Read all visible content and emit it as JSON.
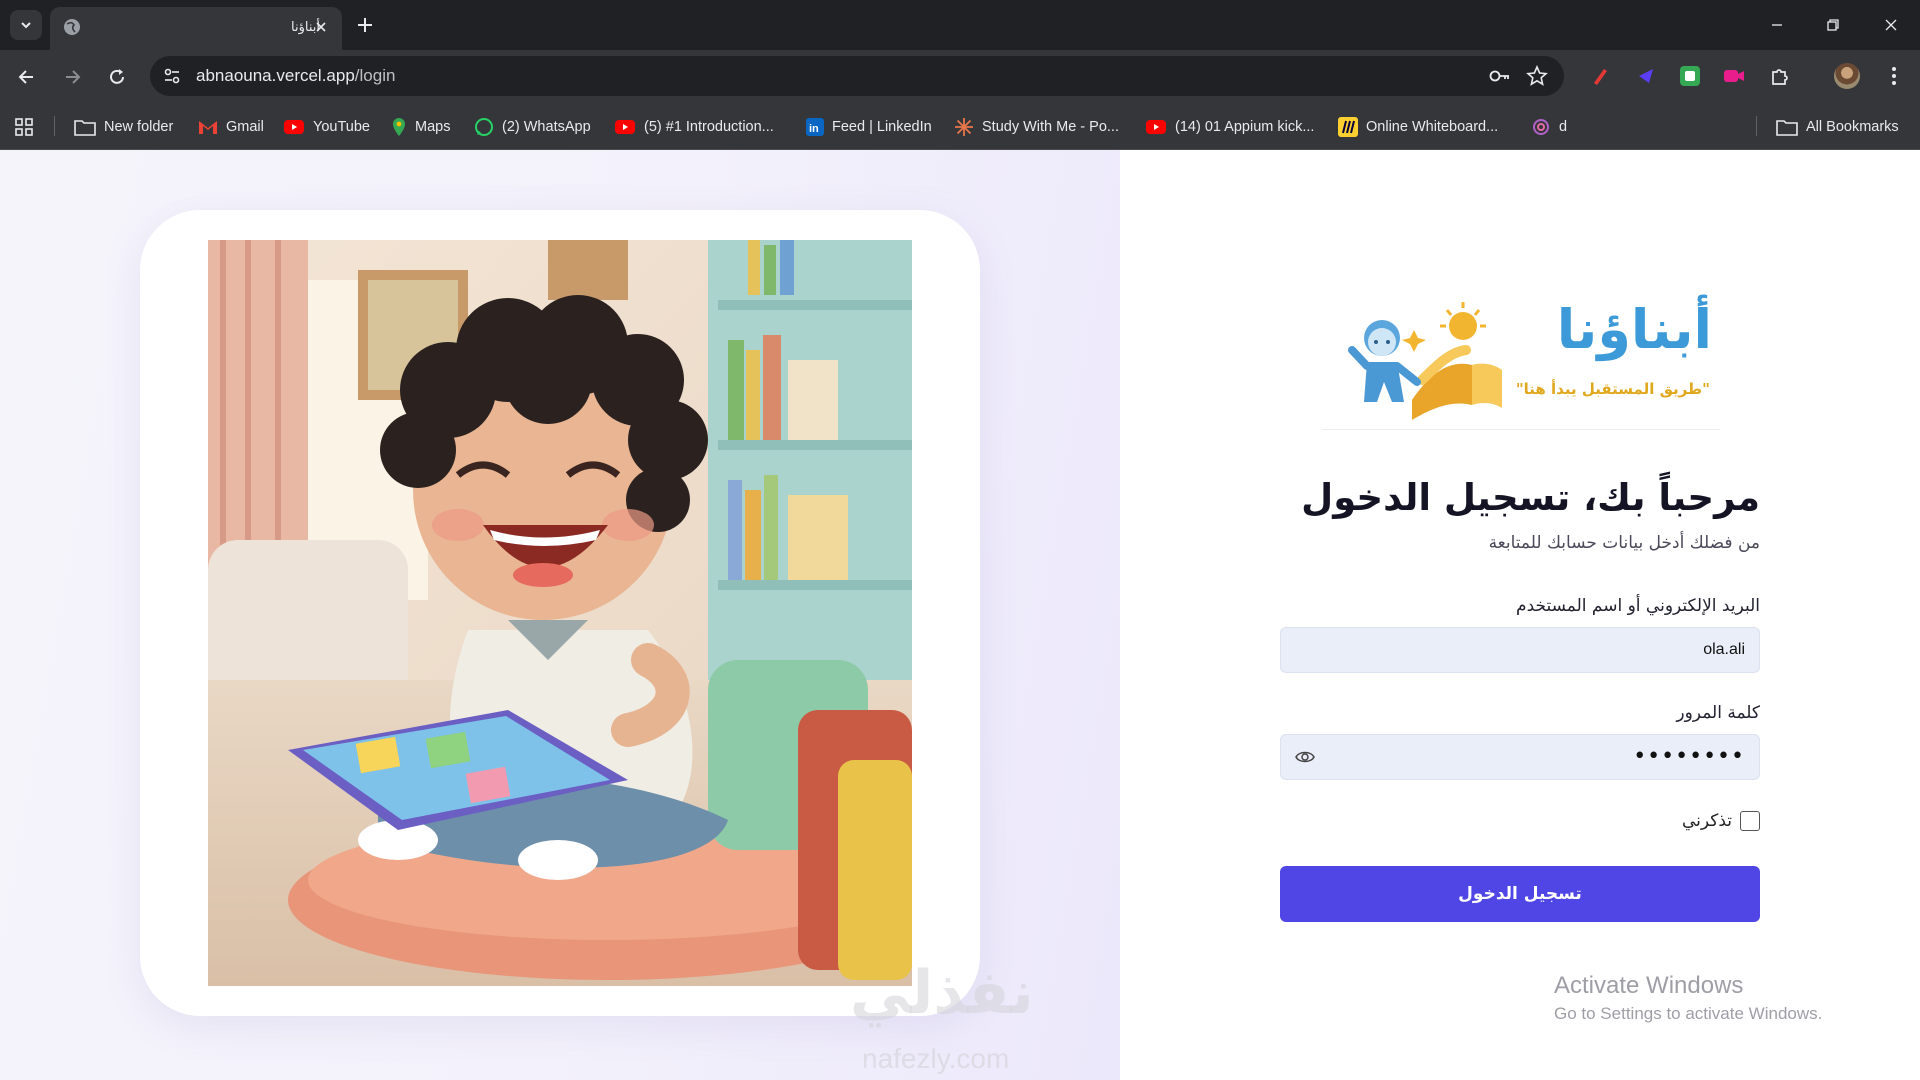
{
  "browser": {
    "tab": {
      "title": "أبناؤنا"
    },
    "url": {
      "host": "abnaouna.vercel.app",
      "path": "/login"
    },
    "bookmarks": [
      {
        "label": "New folder",
        "icon": "folder-icon"
      },
      {
        "label": "Gmail",
        "icon": "gmail-icon"
      },
      {
        "label": "YouTube",
        "icon": "youtube-icon"
      },
      {
        "label": "Maps",
        "icon": "maps-icon"
      },
      {
        "label": "(2) WhatsApp",
        "icon": "whatsapp-icon"
      },
      {
        "label": "(5) #1 Introduction...",
        "icon": "youtube-icon"
      },
      {
        "label": "Feed | LinkedIn",
        "icon": "linkedin-icon"
      },
      {
        "label": "Study With Me - Po...",
        "icon": "sparkle-icon"
      },
      {
        "label": "(14) 01 Appium kick...",
        "icon": "youtube-icon"
      },
      {
        "label": "Online Whiteboard...",
        "icon": "miro-icon"
      },
      {
        "label": "d",
        "icon": "spiral-icon"
      }
    ],
    "all_bookmarks": "All Bookmarks"
  },
  "brand": {
    "name": "أبناؤنا",
    "tagline": "\"طريق المستقبل يبدأ هنا\"",
    "colors": {
      "primary": "#4f46e5",
      "logo_blue": "#3d9ad8",
      "logo_gold": "#e0a81e"
    }
  },
  "login": {
    "welcome": "مرحباً بك، تسجيل الدخول",
    "subtitle": "من فضلك أدخل بيانات حسابك للمتابعة",
    "username_label": "البريد الإلكتروني أو اسم المستخدم",
    "username_value": "ola.ali",
    "password_label": "كلمة المرور",
    "password_value": "••••••••",
    "remember_label": "تذكرني",
    "submit_label": "تسجيل الدخول"
  },
  "watermark": {
    "arabic": "نفذلي",
    "latin": "nafezly.com"
  },
  "os_overlay": {
    "activate_title": "Activate Windows",
    "activate_sub": "Go to Settings to activate Windows."
  }
}
